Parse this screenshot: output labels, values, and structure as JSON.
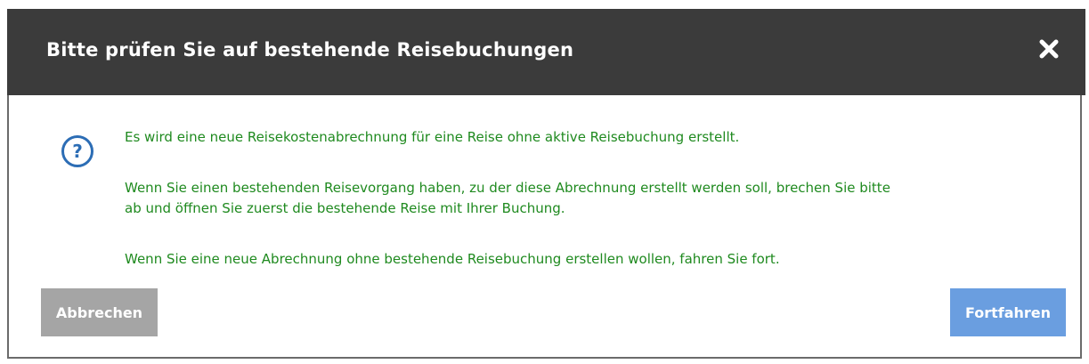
{
  "dialog": {
    "title": "Bitte prüfen Sie auf bestehende Reisebuchungen",
    "close_icon": "close-icon",
    "question_icon": "question-mark-icon",
    "question_glyph": "?",
    "messages": {
      "line1": "Es wird eine neue Reisekostenabrechnung für eine Reise ohne aktive Reisebuchung erstellt.",
      "line2": "Wenn Sie einen bestehenden Reisevorgang haben, zu der diese Abrechnung erstellt werden soll, brechen Sie bitte",
      "line3": "ab und öffnen Sie zuerst die bestehende Reise mit Ihrer Buchung.",
      "line4": "Wenn Sie eine neue Abrechnung ohne bestehende Reisebuchung erstellen wollen, fahren Sie fort."
    },
    "buttons": {
      "cancel_label": "Abbrechen",
      "continue_label": "Fortfahren"
    }
  },
  "colors": {
    "header_bg": "#3b3b3b",
    "message_text": "#1f8a1f",
    "icon_blue": "#2c6db5",
    "cancel_bg": "#a5a5a5",
    "continue_bg": "#6a9ee0"
  }
}
